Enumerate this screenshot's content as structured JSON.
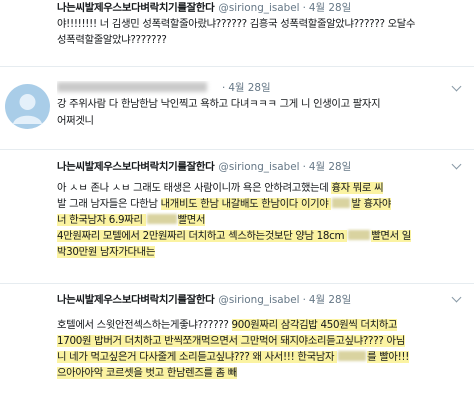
{
  "colors": {
    "highlight": "#fbf3a2",
    "name_text": "#14171a",
    "meta_text": "#657786",
    "avatar_bg": "#a9cde8",
    "divider": "#e6ecf0"
  },
  "icons": {
    "menu": "chevron-down-icon",
    "avatar": "default-avatar-icon"
  },
  "tweets": [
    {
      "display_name": "나는씨발제우스보다벼락치기를잘한다",
      "handle": "@siriong_isabel",
      "separator": "·",
      "date": "4월 28일",
      "lines": [
        [
          "야!!!!!!!! 너 김생민 성폭력할줄아랐냐?????? 김흥국 성폭력할줄알았냐?????? 오달수"
        ],
        [
          "성폭력할줄알았냐???????"
        ]
      ]
    },
    {
      "separator": "·",
      "date": "4월 28일",
      "lines": [
        [
          "강 주위사람 다 한남한남 낙인찍고 욕하고 다녀ㅋㅋㅋ 그게 니 인생이고 팔자지"
        ],
        [
          "어쩌겟니"
        ]
      ]
    },
    {
      "display_name": "나는씨발제우스보다벼락치기를잘한다",
      "handle": "@siriong_isabel",
      "separator": "·",
      "date": "4월 28일",
      "lines": [
        [
          "아 ㅅㅂ 존나 ㅅㅂ 그래도 태생은 사람이니까 욕은 안하려고했는데 ",
          "흉자 뭐로 씨"
        ],
        [
          "발 그래 남자들은 다한남 ",
          "내개비도 한남 내갈배도 한남이다 이기야 ",
          "발 흉자야"
        ],
        [
          "너 한국남자 6.9짜리 ",
          "빨면서"
        ],
        [
          "4만원짜리 모텔에서 2만원짜리 더치하고 섹스하는것보단 양남 18cm ",
          "빨면서 일"
        ],
        [
          "박30만원 남자가다내는"
        ]
      ]
    },
    {
      "display_name": "나는씨발제우스보다벼락치기를잘한다",
      "handle": "@siriong_isabel",
      "separator": "·",
      "date": "4월 28일",
      "lines": [
        [
          "호텔에서 스윗안전섹스하는게좋냐?????? ",
          "900원짜리 삼각김밥 450원씩 더치하고"
        ],
        [
          "1700원 밥버거 더치하고 반씩쪼개먹으면서 그만먹어 돼지야소리듣고싶냐???? 아님"
        ],
        [
          "니 네가 먹고싶은거 다사줄게 소리듣고싶냐??? 왜 사서!!! 한국남자 ",
          "를 빨아!!!"
        ],
        [
          "으아아아악 코르셋을 벗고 한남렌즈를 좀 빼"
        ]
      ]
    }
  ]
}
